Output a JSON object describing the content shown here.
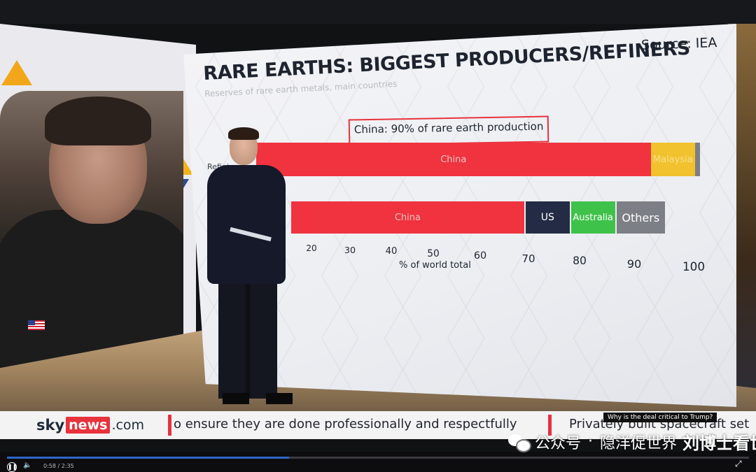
{
  "chart": {
    "title": "RARE EARTHS: BIGGEST PRODUCERS/REFINERS",
    "subtitle": "Reserves of rare earth metals, main countries",
    "source": "Source: IEA",
    "callout": "China: 90% of rare earth production",
    "axis_label": "% of world total",
    "row_label_refining": "Refining"
  },
  "chart_data": {
    "type": "bar",
    "orientation": "horizontal-stacked",
    "title": "RARE EARTHS: BIGGEST PRODUCERS/REFINERS",
    "subtitle": "Reserves of rare earth metals, main countries",
    "xlabel": "% of world total",
    "xlim": [
      10,
      100
    ],
    "x_ticks": [
      20,
      30,
      40,
      50,
      60,
      70,
      80,
      90,
      100
    ],
    "rows": [
      {
        "label": "Refining",
        "segments": [
          {
            "name": "China",
            "start": 10,
            "end": 90,
            "color": "#f0333f"
          },
          {
            "name": "Malaysia",
            "start": 90,
            "end": 99,
            "color": "#f2c12e"
          },
          {
            "name": "",
            "start": 99,
            "end": 100,
            "color": "#7d7f86"
          }
        ]
      },
      {
        "label": "",
        "segments": [
          {
            "name": "China",
            "start": 10,
            "end": 69,
            "color": "#f0333f"
          },
          {
            "name": "US",
            "start": 69,
            "end": 79,
            "color": "#232c44"
          },
          {
            "name": "Australia",
            "start": 79,
            "end": 89,
            "color": "#3fc24a"
          },
          {
            "name": "Others",
            "start": 89,
            "end": 100,
            "color": "#7d7f86"
          }
        ]
      }
    ]
  },
  "ticker": {
    "logo_sky": "sky",
    "logo_news": "news",
    "logo_com": ".com",
    "headline_1": "o ensure they are done professionally and respectfully",
    "headline_2": "Privately built spacecraft set",
    "tooltip": "Why is the deal critical to Trump?"
  },
  "player": {
    "time": "0:58 / 2:35",
    "progress": 0.38,
    "play_icon": "pause-icon",
    "volume_icon": "volume-icon"
  },
  "watermark": {
    "channel": "公众号",
    "dot": "·",
    "name": "隐洋促世界",
    "author": "刘博士看世界"
  },
  "colors": {
    "accent_red": "#e8323c",
    "china_red": "#f0333f",
    "malaysia_yellow": "#f2c12e",
    "us_navy": "#232c44",
    "australia_green": "#3fc24a",
    "others_grey": "#7d7f86"
  }
}
